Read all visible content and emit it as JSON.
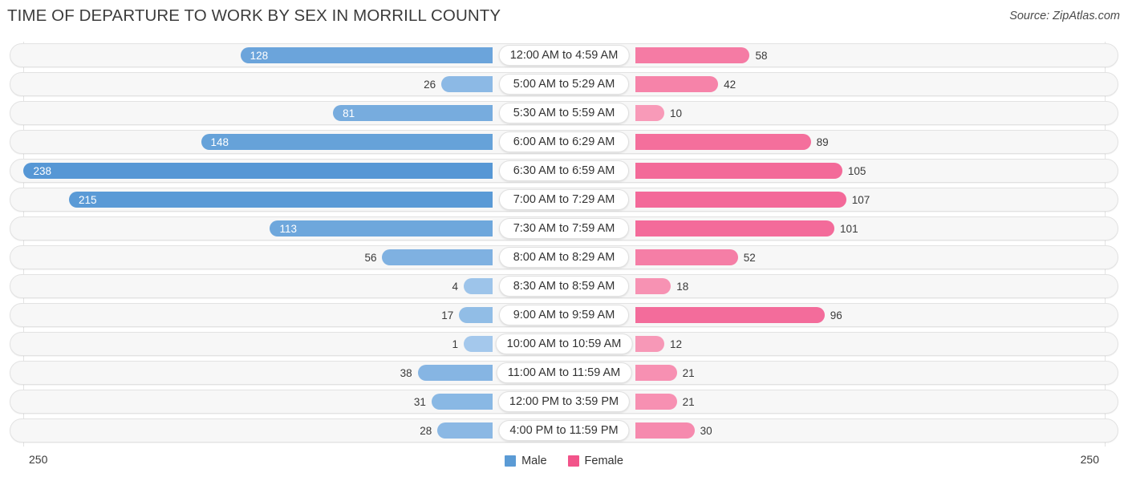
{
  "header": {
    "title": "TIME OF DEPARTURE TO WORK BY SEX IN MORRILL COUNTY",
    "source": "Source: ZipAtlas.com"
  },
  "footer": {
    "axis_left": "250",
    "axis_right": "250",
    "legend": [
      {
        "label": "Male",
        "color": "#5b9bd5"
      },
      {
        "label": "Female",
        "color": "#f2548a"
      }
    ]
  },
  "chart_data": {
    "type": "bar",
    "orientation": "horizontal-diverging",
    "title": "TIME OF DEPARTURE TO WORK BY SEX IN MORRILL COUNTY",
    "xlabel": "",
    "ylabel": "",
    "xlim": [
      250,
      250
    ],
    "axis_max": 250,
    "grid": false,
    "legend_position": "bottom-center",
    "categories": [
      "12:00 AM to 4:59 AM",
      "5:00 AM to 5:29 AM",
      "5:30 AM to 5:59 AM",
      "6:00 AM to 6:29 AM",
      "6:30 AM to 6:59 AM",
      "7:00 AM to 7:29 AM",
      "7:30 AM to 7:59 AM",
      "8:00 AM to 8:29 AM",
      "8:30 AM to 8:59 AM",
      "9:00 AM to 9:59 AM",
      "10:00 AM to 10:59 AM",
      "11:00 AM to 11:59 AM",
      "12:00 PM to 3:59 PM",
      "4:00 PM to 11:59 PM"
    ],
    "series": [
      {
        "name": "Male",
        "color": "#5b9bd5",
        "values": [
          128,
          26,
          81,
          148,
          238,
          215,
          113,
          56,
          4,
          17,
          1,
          38,
          31,
          28
        ]
      },
      {
        "name": "Female",
        "color": "#f2548a",
        "values": [
          58,
          42,
          10,
          89,
          105,
          107,
          101,
          52,
          18,
          96,
          12,
          21,
          21,
          30
        ]
      }
    ]
  }
}
